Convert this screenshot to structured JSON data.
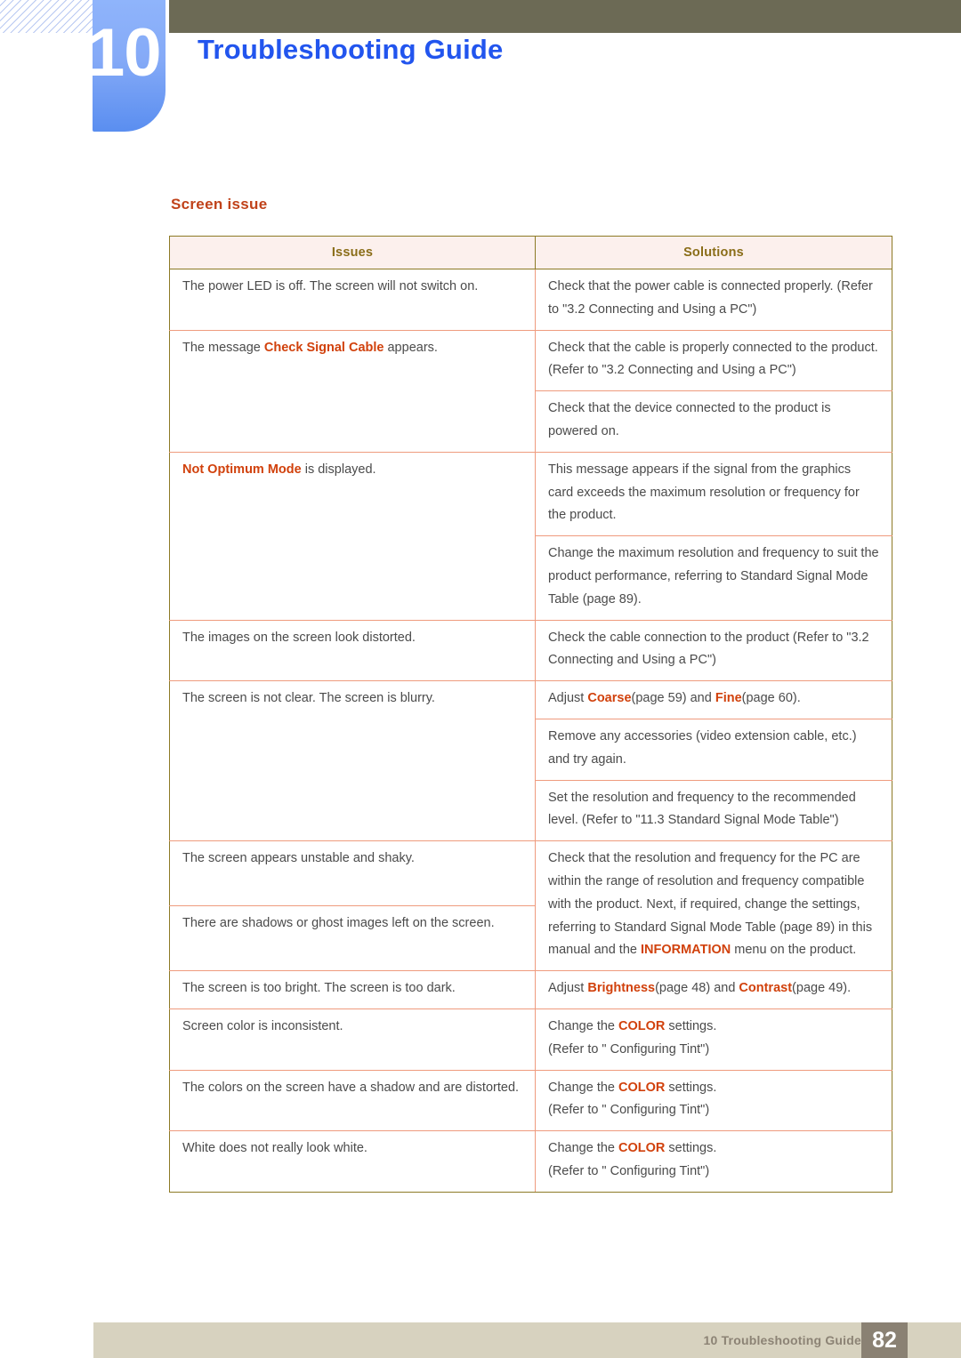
{
  "header": {
    "chapter_number": "10",
    "title": "Troubleshooting Guide",
    "accent_blue": "#2255ee",
    "chapter_block_color": "#6f9ef5",
    "olive_bar_color": "#6c6a55"
  },
  "section": {
    "heading": "Screen issue",
    "heading_color": "#c0421a"
  },
  "table": {
    "columns": [
      "Issues",
      "Solutions"
    ],
    "rows": [
      {
        "issue": "The power LED is off. The screen will not switch on.",
        "solutions": [
          "Check that the power cable is connected properly. (Refer to \"3.2 Connecting and Using a PC\")"
        ]
      },
      {
        "issue_prefix": "The message ",
        "issue_highlight": "Check Signal Cable",
        "issue_suffix": " appears.",
        "solutions": [
          "Check that the cable is properly connected to the product. (Refer to \"3.2 Connecting and Using a PC\")",
          "Check that the device connected to the product is powered on."
        ]
      },
      {
        "issue_highlight": "Not Optimum Mode",
        "issue_suffix": " is displayed.",
        "solutions": [
          "This message appears if the signal from the graphics card exceeds the maximum resolution or frequency for the product.",
          "Change the maximum resolution and frequency to suit the product performance, referring to Standard Signal Mode Table (page 89)."
        ]
      },
      {
        "issue": "The images on the screen look distorted.",
        "solutions": [
          "Check the cable connection to the product (Refer to \"3.2 Connecting and Using a PC\")"
        ]
      },
      {
        "issue": "The screen is not clear. The screen is blurry.",
        "solutions": [
          "Adjust Coarse(page 59) and Fine(page 60).",
          "Remove any accessories (video extension cable, etc.) and try again.",
          "Set the resolution and frequency to the recommended level. (Refer to \"11.3 Standard Signal Mode Table\")"
        ]
      },
      {
        "issue": "The screen appears unstable and shaky.",
        "issue2": "There are shadows or ghost images left on the screen.",
        "solutions": [
          "Check that the resolution and frequency for the PC are within the range of resolution and frequency compatible with the product. Next, if required, change the settings, referring to Standard Signal Mode Table (page 89) in this manual and the INFORMATION menu on the product."
        ]
      },
      {
        "issue": "The screen is too bright. The screen is too dark.",
        "solutions": [
          "Adjust Brightness(page 48) and Contrast(page 49)."
        ]
      },
      {
        "issue": "Screen color is inconsistent.",
        "solutions": [
          "Change the COLOR settings.",
          "(Refer to \" Configuring Tint\")"
        ]
      },
      {
        "issue": "The colors on the screen have a shadow and are distorted.",
        "solutions": [
          "Change the COLOR settings.",
          "(Refer to \" Configuring Tint\")"
        ]
      },
      {
        "issue": "White does not really look white.",
        "solutions": [
          "Change the COLOR settings.",
          "(Refer to \" Configuring Tint\")"
        ]
      }
    ],
    "cells": {
      "r1_issue": "The power LED is off. The screen will not switch on.",
      "r1_sol1": "Check that the power cable is connected properly. (Refer to \"3.2 Connecting and Using a PC\")",
      "r2_issue_pre": "The message ",
      "r2_issue_hl": "Check Signal Cable",
      "r2_issue_post": " appears.",
      "r2_sol1": "Check that the cable is properly connected to the product. (Refer to \"3.2 Connecting and Using a PC\")",
      "r2_sol2": "Check that the device connected to the product is powered on.",
      "r3_issue_hl": "Not Optimum Mode",
      "r3_issue_post": " is displayed.",
      "r3_sol1": "This message appears if the signal from the graphics card exceeds the maximum resolution or frequency for the product.",
      "r3_sol2": "Change the maximum resolution and frequency to suit the product performance, referring to Standard Signal Mode Table (page 89).",
      "r4_issue": "The images on the screen look distorted.",
      "r4_sol1": "Check the cable connection to the product (Refer to \"3.2 Connecting and Using a PC\")",
      "r5_issue": "The screen is not clear. The screen is blurry.",
      "r5_sol1_pre": "Adjust ",
      "r5_sol1_hl1": "Coarse",
      "r5_sol1_mid": "(page 59) and ",
      "r5_sol1_hl2": "Fine",
      "r5_sol1_post": "(page 60).",
      "r5_sol2": "Remove any accessories (video extension cable, etc.) and try again.",
      "r5_sol3": "Set the resolution and frequency to the recommended level. (Refer to \"11.3 Standard Signal Mode Table\")",
      "r6_issue": "The screen appears unstable and shaky.",
      "r7_issue": "There are shadows or ghost images left on the screen.",
      "r6_sol1_pre": "Check that the resolution and frequency for the PC are within the range of resolution and frequency compatible with the product. Next, if required, change the settings, referring to Standard Signal Mode Table (page 89) in this manual and the ",
      "r6_sol1_hl": "INFORMATION",
      "r6_sol1_post": " menu on the product.",
      "r8_issue": "The screen is too bright. The screen is too dark.",
      "r8_sol1_pre": "Adjust ",
      "r8_sol1_hl1": "Brightness",
      "r8_sol1_mid": "(page 48) and ",
      "r8_sol1_hl2": "Contrast",
      "r8_sol1_post": "(page 49).",
      "r9_issue": "Screen color is inconsistent.",
      "r9_sol1_pre": "Change the ",
      "r9_sol1_hl": "COLOR",
      "r9_sol1_post": " settings.",
      "r9_sol2": "(Refer to \" Configuring Tint\")",
      "r10_issue": "The colors on the screen have a shadow and are distorted.",
      "r10_sol1_pre": "Change the ",
      "r10_sol1_hl": "COLOR",
      "r10_sol1_post": " settings.",
      "r10_sol2": "(Refer to \" Configuring Tint\")",
      "r11_issue": "White does not really look white.",
      "r11_sol1_pre": "Change the ",
      "r11_sol1_hl": "COLOR",
      "r11_sol1_post": " settings.",
      "r11_sol2": "(Refer to \" Configuring Tint\")"
    }
  },
  "footer": {
    "label": "10 Troubleshooting Guide",
    "page_number": "82"
  }
}
